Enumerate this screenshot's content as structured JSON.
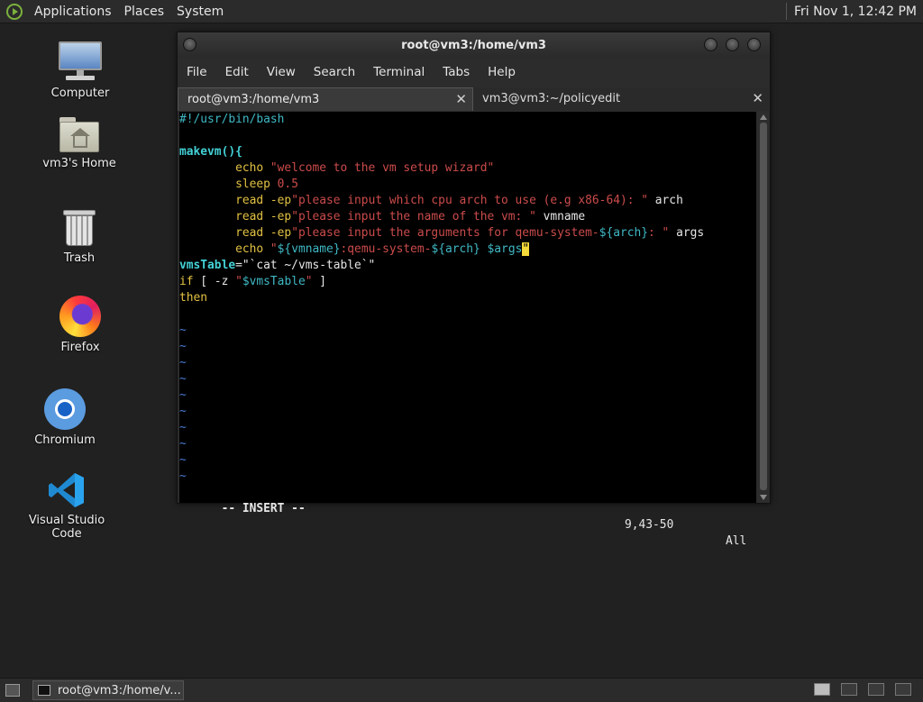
{
  "top_panel": {
    "menus": [
      "Applications",
      "Places",
      "System"
    ],
    "clock": "Fri Nov  1, 12:42 PM"
  },
  "desktop_icons": [
    {
      "label": "Computer",
      "icon": "computer-icon"
    },
    {
      "label": "vm3's Home",
      "icon": "home-folder-icon"
    },
    {
      "label": "Trash",
      "icon": "trash-icon"
    },
    {
      "label": "Firefox",
      "icon": "firefox-icon"
    },
    {
      "label": "Chromium",
      "icon": "chromium-icon"
    },
    {
      "label": "Visual Studio Code",
      "icon": "vscode-icon"
    }
  ],
  "terminal": {
    "title": "root@vm3:/home/vm3",
    "menu": [
      "File",
      "Edit",
      "View",
      "Search",
      "Terminal",
      "Tabs",
      "Help"
    ],
    "tabs": [
      {
        "label": "root@vm3:/home/vm3",
        "active": true
      },
      {
        "label": "vm3@vm3:~/policyedit",
        "active": false
      }
    ],
    "lines": {
      "l1": "#!/usr/bin/bash",
      "l3_func": "makevm(){",
      "l4_cmd": "echo",
      "l4_str": "\"welcome to the vm setup wizard\"",
      "l5_cmd": "sleep",
      "l5_arg": "0.5",
      "l6_cmd": "read",
      "l6_opt": "-ep",
      "l6_str": "\"please input which cpu arch to use (e.g x86-64): \"",
      "l6_var": "arch",
      "l7_cmd": "read",
      "l7_opt": "-ep",
      "l7_str": "\"please input the name of the vm: \"",
      "l7_var": "vmname",
      "l8_cmd": "read",
      "l8_opt": "-ep",
      "l8_str_a": "\"please input the arguments for qemu-system-",
      "l8_str_var": "${arch}",
      "l8_str_b": ": \"",
      "l8_var": "args",
      "l9_cmd": "echo",
      "l9_q": "\"",
      "l9_v1": "${vmname}",
      "l9_mid": ":qemu-system-",
      "l9_v2": "${arch}",
      "l9_sp": " ",
      "l9_v3": "$args",
      "l9_cursor": "\"",
      "l10_var": "vmsTable",
      "l10_eq": "=",
      "l10_str": "\"`cat ~/vms-table`\"",
      "l11_kw": "if",
      "l11_a": " [ -z ",
      "l11_q1": "\"",
      "l11_v": "$vmsTable",
      "l11_q2": "\"",
      "l11_b": " ]",
      "l12_kw": "then",
      "tilde": "~"
    },
    "status": {
      "mode": "-- INSERT --",
      "position": "9,43-50",
      "scroll": "All"
    }
  },
  "bottom_panel": {
    "task": "root@vm3:/home/v..."
  }
}
